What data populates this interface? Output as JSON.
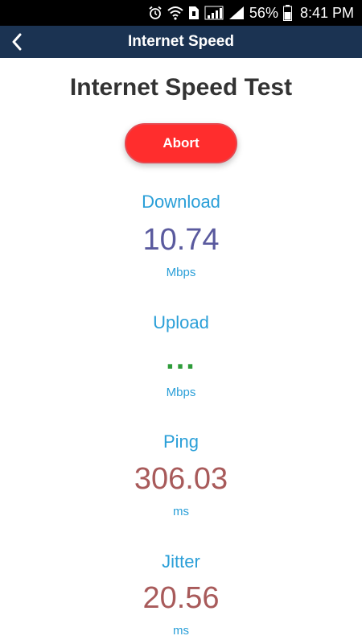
{
  "status_bar": {
    "battery_percent": "56%",
    "time": "8:41 PM",
    "icons": [
      "alarm-icon",
      "wifi-icon",
      "sim-icon",
      "signal-icon",
      "signal-icon-2",
      "battery-icon"
    ]
  },
  "app_bar": {
    "title": "Internet Speed",
    "back_icon": "chevron-left-icon"
  },
  "heading": "Internet Speed Test",
  "abort_label": "Abort",
  "metrics": {
    "download": {
      "label": "Download",
      "value": "10.74",
      "unit": "Mbps",
      "value_color": "#5a5a9e"
    },
    "upload": {
      "label": "Upload",
      "value": "...",
      "unit": "Mbps",
      "value_color": "#2e9c3a"
    },
    "ping": {
      "label": "Ping",
      "value": "306.03",
      "unit": "ms",
      "value_color": "#a85a5a"
    },
    "jitter": {
      "label": "Jitter",
      "value": "20.56",
      "unit": "ms",
      "value_color": "#a85a5a"
    }
  },
  "colors": {
    "app_bar_bg": "#1b3352",
    "label_blue": "#2a9fd8",
    "abort_red": "#ff2d2d"
  }
}
